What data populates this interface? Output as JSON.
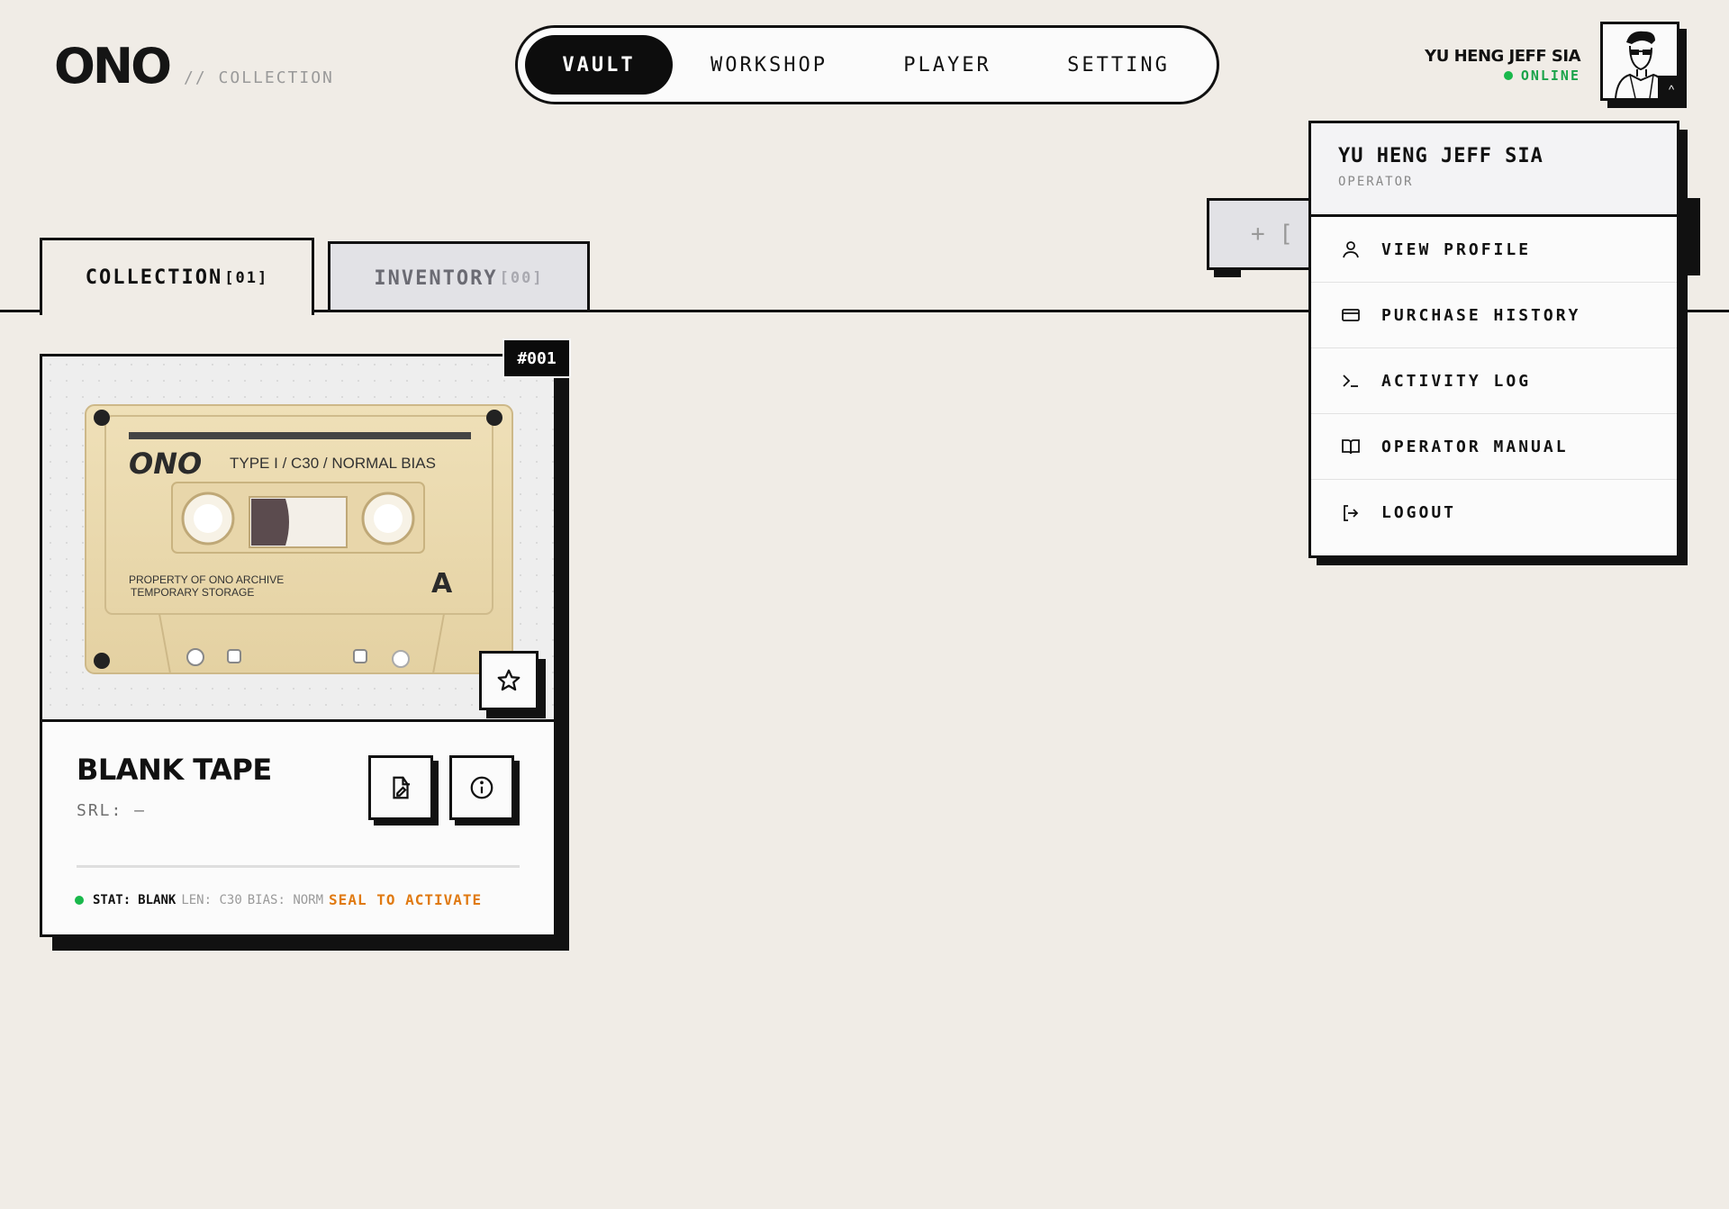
{
  "header": {
    "logo": "ONO",
    "logo_sub": "// COLLECTION",
    "nav": [
      {
        "label": "VAULT",
        "active": true
      },
      {
        "label": "WORKSHOP",
        "active": false
      },
      {
        "label": "PLAYER",
        "active": false
      },
      {
        "label": "SETTING",
        "active": false
      }
    ],
    "user": {
      "name": "YU HENG JEFF SIA",
      "status": "ONLINE",
      "status_color": "#19b84b"
    }
  },
  "tabs": [
    {
      "label": "COLLECTION",
      "count": "[01]",
      "active": true
    },
    {
      "label": "INVENTORY",
      "count": "[00]",
      "active": false
    }
  ],
  "add_button": {
    "label": "+ ["
  },
  "card": {
    "badge": "#001",
    "image": {
      "brand": "ONO",
      "spec": "TYPE I / C30 / NORMAL BIAS",
      "line1": "PROPERTY OF ONO ARCHIVE",
      "line2": "TEMPORARY STORAGE",
      "side": "A"
    },
    "title": "BLANK TAPE",
    "srl": "SRL: —",
    "stats": {
      "stat_label": "STAT:",
      "stat_value": "BLANK",
      "len": "LEN: C30",
      "bias": "BIAS: NORM",
      "action": "SEAL TO ACTIVATE",
      "action_color": "#e07a12"
    }
  },
  "dropdown": {
    "name": "YU HENG JEFF SIA",
    "role": "OPERATOR",
    "items": [
      {
        "label": "VIEW PROFILE",
        "icon": "user-icon"
      },
      {
        "label": "PURCHASE HISTORY",
        "icon": "credit-card-icon"
      },
      {
        "label": "ACTIVITY LOG",
        "icon": "terminal-icon"
      },
      {
        "label": "OPERATOR MANUAL",
        "icon": "book-icon"
      },
      {
        "label": "LOGOUT",
        "icon": "logout-icon"
      }
    ]
  }
}
